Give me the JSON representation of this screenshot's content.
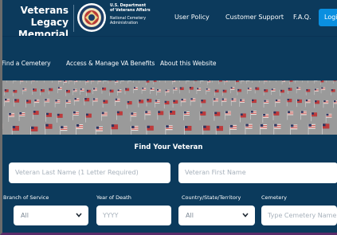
{
  "header": {
    "site_title_line1": "Veterans Legacy",
    "site_title_line2": "Memorial",
    "va_line1": "U.S. Department",
    "va_line2": "of Veterans Affairs",
    "va_line3": "National Cemetery",
    "va_line4": "Administration",
    "links": [
      "User Policy",
      "Customer Support",
      "F.A.Q."
    ],
    "login_label": "Logi"
  },
  "nav": {
    "items": [
      "Find a Cemetery",
      "Access & Manage VA Benefits",
      "About this Website"
    ]
  },
  "search": {
    "title": "Find Your Veteran",
    "last_name_placeholder": "Veteran Last Name (1 Letter Required)",
    "first_name_placeholder": "Veteran First Name",
    "labels": {
      "branch": "Branch of Service",
      "year": "Year of Death",
      "country": "Country/State/Territory",
      "cemetery": "Cemetery"
    },
    "branch_value": "All",
    "year_placeholder": "YYYY",
    "country_value": "All",
    "cemetery_placeholder": "Type Cemetery Name"
  },
  "colors": {
    "header_bg": "#0c3a5c",
    "page_bg": "#0b3a5c",
    "accent": "#0a8fe0"
  },
  "icons": [
    "va-seal-icon",
    "chevron-down-icon"
  ]
}
